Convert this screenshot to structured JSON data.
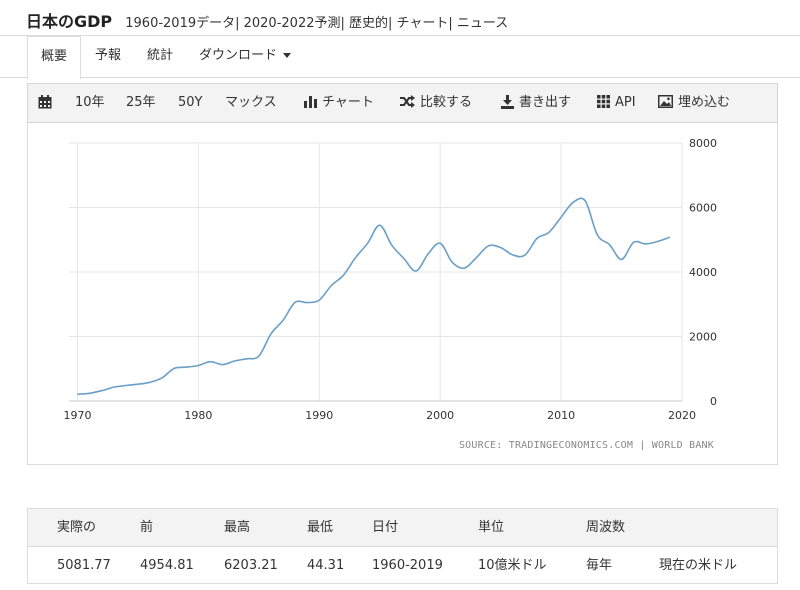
{
  "header": {
    "title": "日本のGDP",
    "subtitle": "1960-2019データ| 2020-2022予測| 歴史的| チャート| ニュース"
  },
  "tabs": [
    {
      "label": "概要"
    },
    {
      "label": "予報"
    },
    {
      "label": "統計"
    },
    {
      "label": "ダウンロード"
    }
  ],
  "toolbar": {
    "range_10": "10年",
    "range_25": "25年",
    "range_50": "50Y",
    "range_max": "マックス",
    "chart": "チャート",
    "compare": "比較する",
    "export": "書き出す",
    "api": "API",
    "embed": "埋め込む"
  },
  "source_text": "SOURCE: TRADINGECONOMICS.COM | WORLD BANK",
  "stats": {
    "headers": [
      "実際の",
      "前",
      "最高",
      "最低",
      "日付",
      "単位",
      "周波数"
    ],
    "values": [
      "5081.77",
      "4954.81",
      "6203.21",
      "44.31",
      "1960-2019",
      "10億米ドル",
      "毎年",
      "現在の米ドル"
    ]
  },
  "chart_data": {
    "type": "line",
    "line_color": "#6a9fc8",
    "title": "",
    "xlabel": "",
    "ylabel": "",
    "xlim": [
      1969.3,
      2020
    ],
    "ylim": [
      0,
      8000
    ],
    "x_ticks": [
      "1970",
      "1980",
      "1990",
      "2000",
      "2010",
      "2020"
    ],
    "y_ticks": [
      "0",
      "2000",
      "4000",
      "6000",
      "8000"
    ],
    "grid": true,
    "y_axis_side": "right",
    "series": [
      {
        "x": [
          1970,
          1971,
          1972,
          1973,
          1974,
          1975,
          1976,
          1977,
          1978,
          1979,
          1980,
          1981,
          1982,
          1983,
          1984,
          1985,
          1986,
          1987,
          1988,
          1989,
          1990,
          1991,
          1992,
          1993,
          1994,
          1995,
          1996,
          1997,
          1998,
          1999,
          2000,
          2001,
          2002,
          2003,
          2004,
          2005,
          2006,
          2007,
          2008,
          2009,
          2010,
          2011,
          2012,
          2013,
          2014,
          2015,
          2016,
          2017,
          2018,
          2019
        ],
        "values": [
          210,
          240,
          320,
          430,
          480,
          520,
          580,
          720,
          1010,
          1050,
          1100,
          1220,
          1130,
          1240,
          1310,
          1390,
          2080,
          2500,
          3060,
          3050,
          3130,
          3580,
          3900,
          4450,
          4890,
          5450,
          4830,
          4420,
          4030,
          4560,
          4890,
          4300,
          4120,
          4450,
          4810,
          4760,
          4530,
          4520,
          5040,
          5230,
          5700,
          6160,
          6200,
          5150,
          4850,
          4390,
          4920,
          4870,
          4950,
          5080
        ]
      }
    ]
  }
}
